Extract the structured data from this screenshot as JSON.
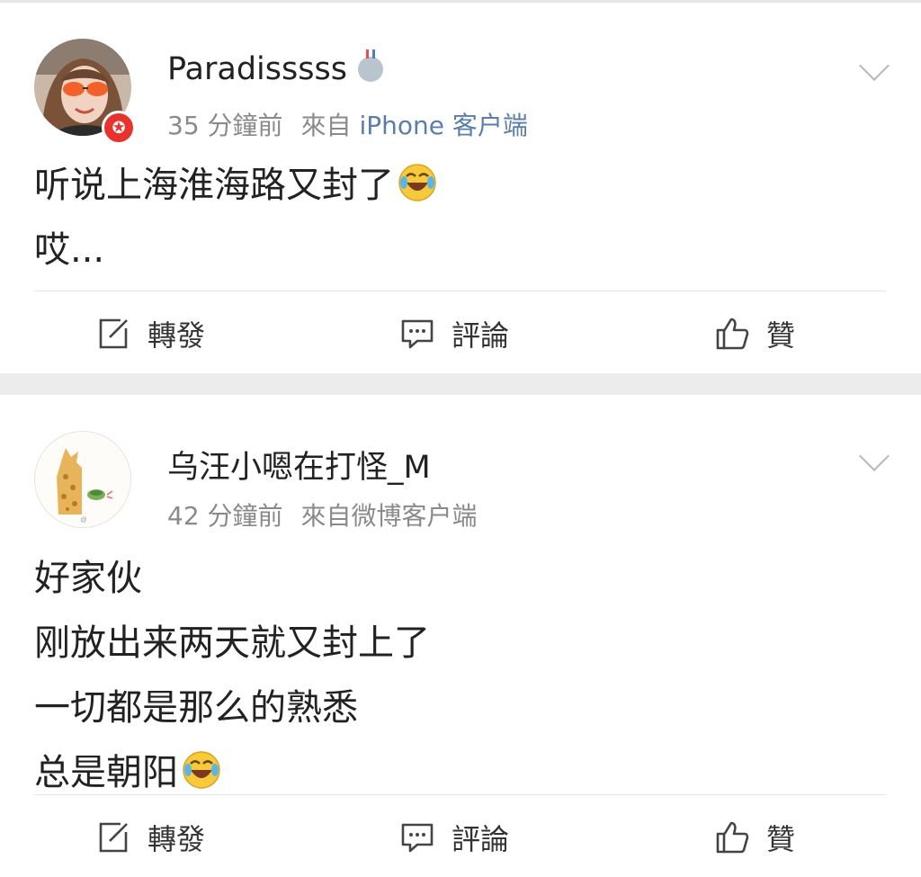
{
  "posts": [
    {
      "username": "Paradisssss",
      "time": "35 分鐘前",
      "from_prefix": "來自",
      "source": "iPhone 客户端",
      "lines": [
        "听说上海淮海路又封了",
        "哎..."
      ],
      "emoji": "laugh-cry-icon",
      "actions": {
        "repost": "轉發",
        "comment": "評論",
        "like": "贊"
      }
    },
    {
      "username": "乌汪小嗯在打怪_M",
      "time": "42 分鐘前",
      "from_prefix": "來自",
      "source": "微博客户端",
      "lines": [
        "好家伙",
        "刚放出来两天就又封上了",
        "一切都是那么的熟悉",
        "总是朝阳"
      ],
      "emoji": "laugh-cry-icon",
      "actions": {
        "repost": "轉發",
        "comment": "評論",
        "like": "贊"
      }
    }
  ],
  "colors": {
    "badge": "#e8332c",
    "source_link": "#5b7ea8",
    "meta": "#8a8a8a",
    "separator": "#ececec"
  }
}
